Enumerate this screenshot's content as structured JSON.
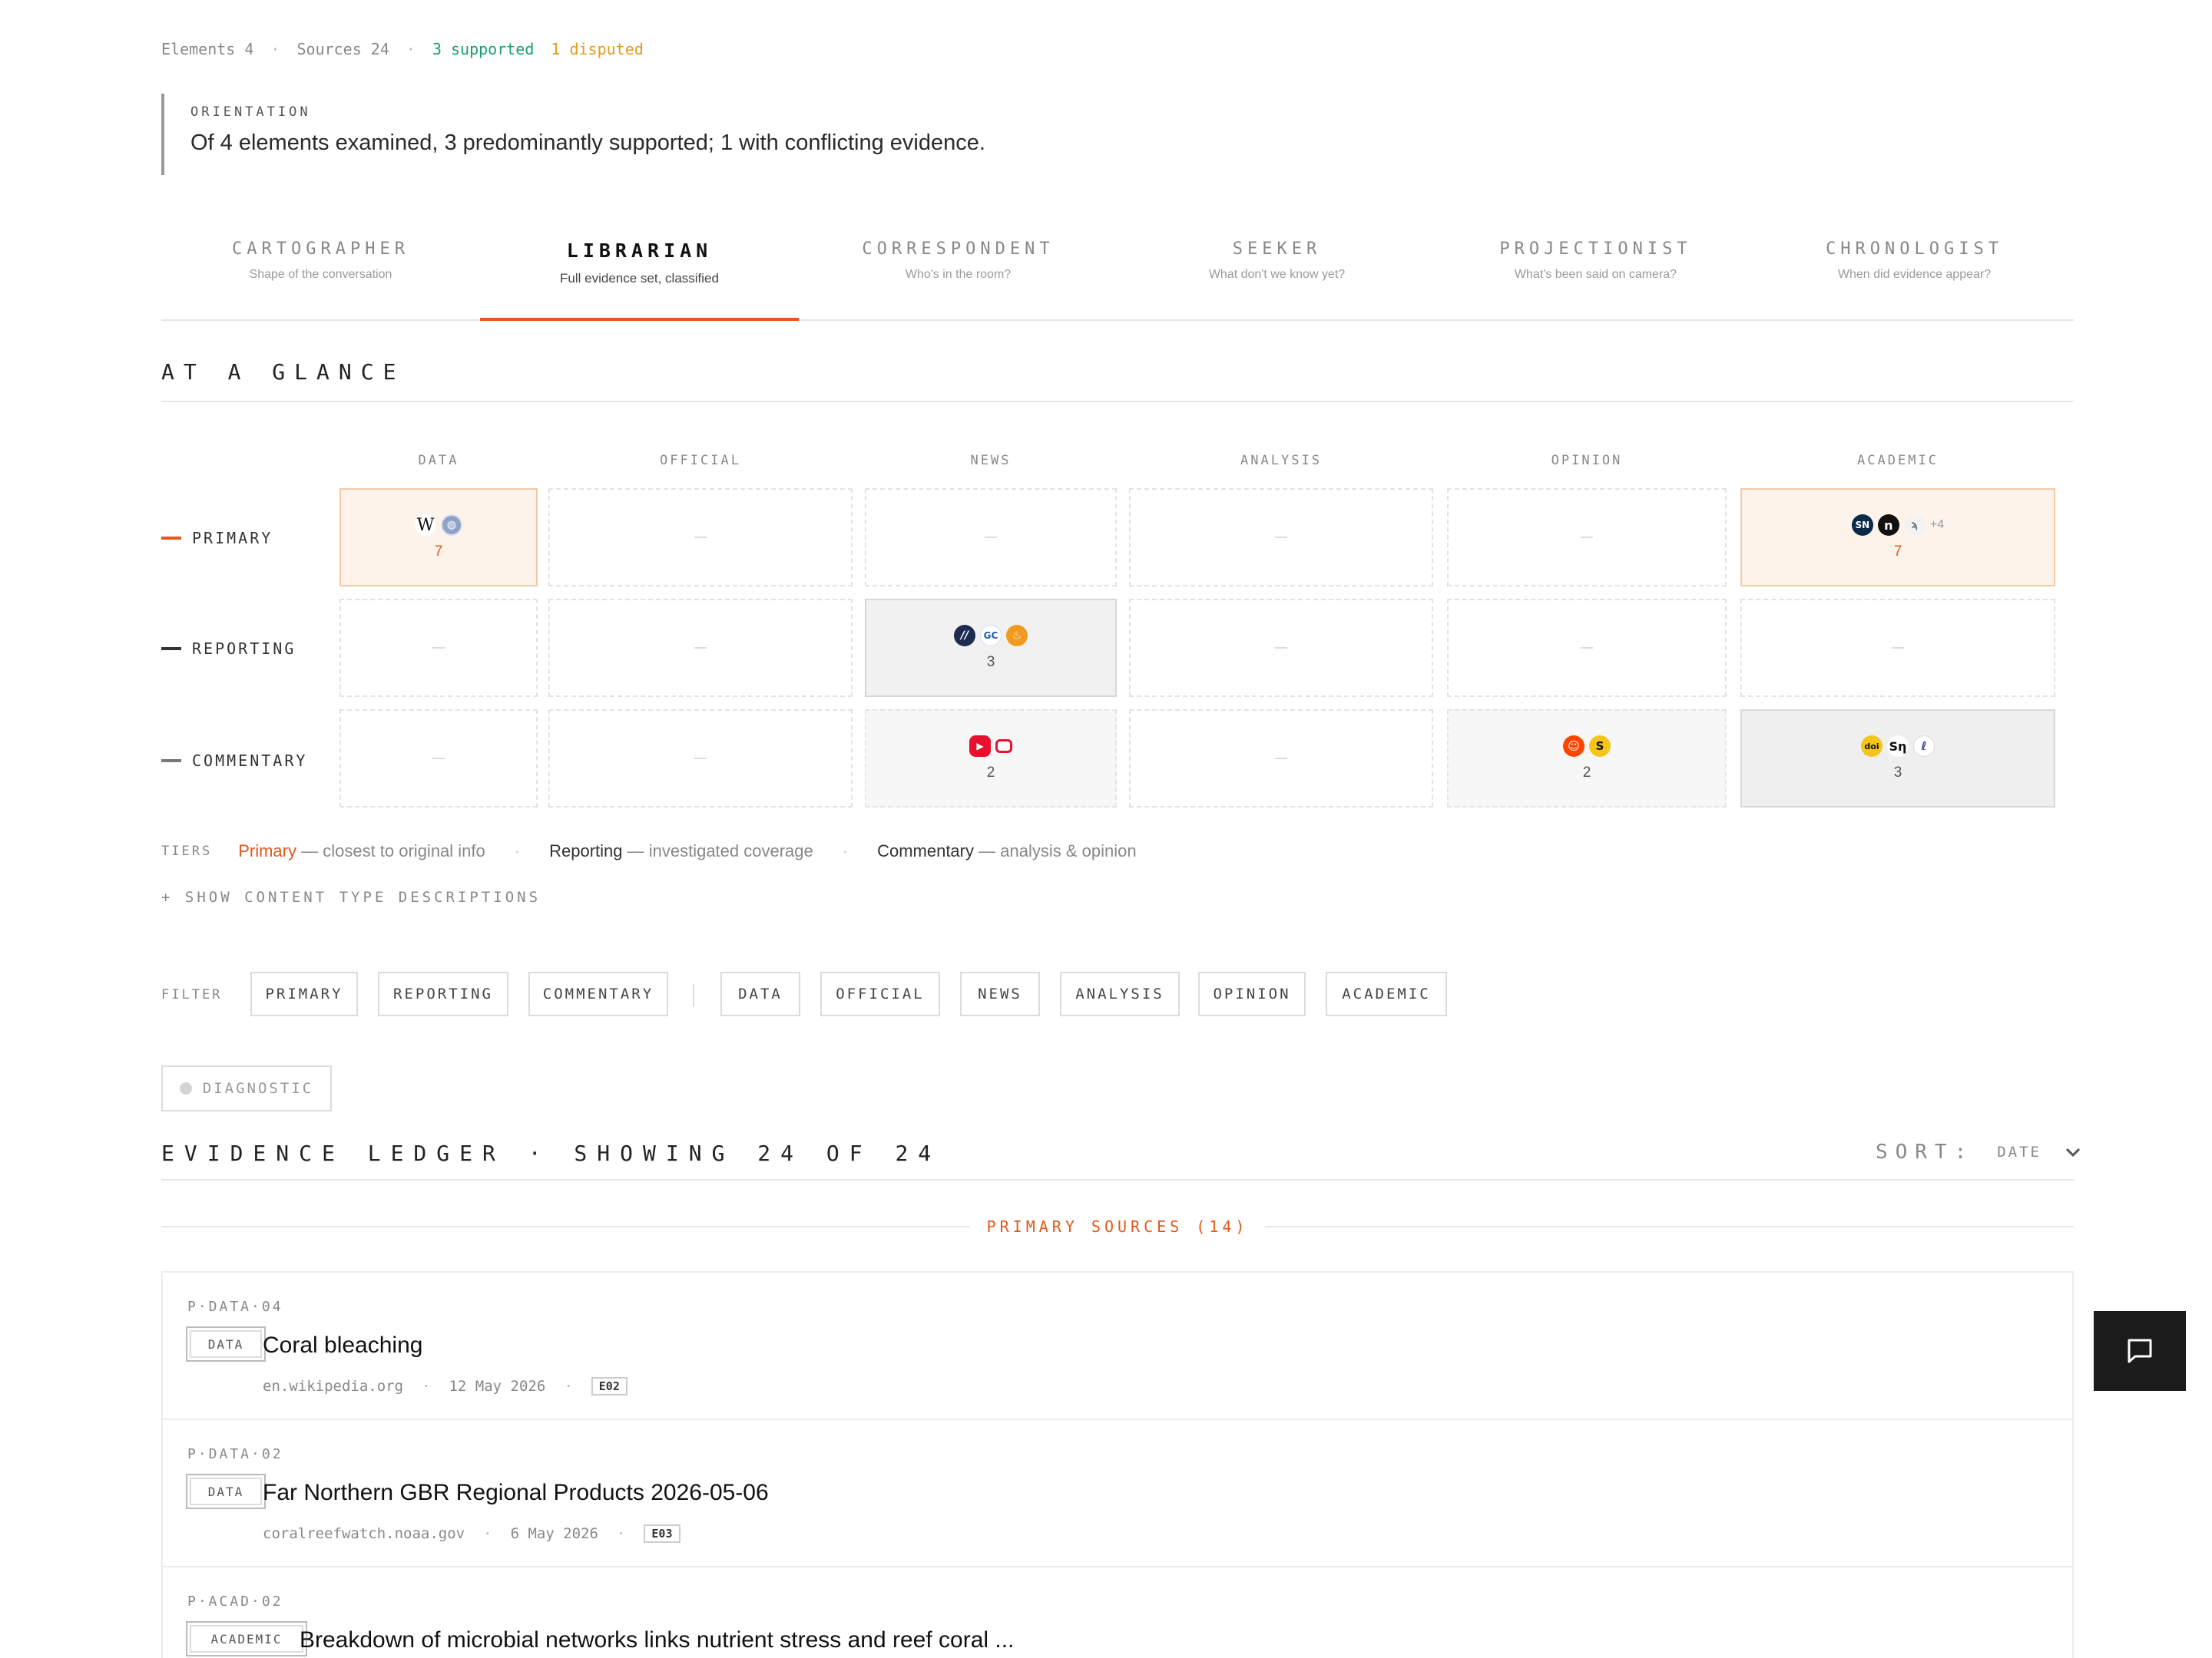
{
  "stats": {
    "elements": "Elements 4",
    "sources": "Sources 24",
    "supported": "3 supported",
    "disputed": "1 disputed"
  },
  "orientation": {
    "label": "ORIENTATION",
    "text": "Of 4 elements examined, 3 predominantly supported; 1 with conflicting evidence."
  },
  "tabs": [
    {
      "title": "CARTOGRAPHER",
      "subtitle": "Shape of the conversation"
    },
    {
      "title": "LIBRARIAN",
      "subtitle": "Full evidence set, classified",
      "active": true
    },
    {
      "title": "CORRESPONDENT",
      "subtitle": "Who's in the room?"
    },
    {
      "title": "SEEKER",
      "subtitle": "What don't we know yet?"
    },
    {
      "title": "PROJECTIONIST",
      "subtitle": "What's been said on camera?"
    },
    {
      "title": "CHRONOLOGIST",
      "subtitle": "When did evidence appear?"
    }
  ],
  "glance": {
    "title": "AT A GLANCE",
    "columns": [
      "DATA",
      "OFFICIAL",
      "NEWS",
      "ANALYSIS",
      "OPINION",
      "ACADEMIC"
    ],
    "rows": [
      "PRIMARY",
      "REPORTING",
      "COMMENTARY"
    ],
    "cells": {
      "primary_data": {
        "count": "7",
        "icons": [
          "wikipedia-icon",
          "globe-icon"
        ]
      },
      "primary_academic": {
        "count": "7",
        "icons": [
          "springer-nature-icon",
          "n-publisher-icon",
          "quill-icon"
        ],
        "more": "+4"
      },
      "reporting_news": {
        "count": "3",
        "icons": [
          "news-outlet-icon",
          "gc-outlet-icon",
          "flame-outlet-icon"
        ]
      },
      "commentary_news": {
        "count": "2",
        "icons": [
          "youtube-icon",
          "video-outlet-icon"
        ]
      },
      "commentary_opinion": {
        "count": "2",
        "icons": [
          "reddit-icon",
          "substack-icon"
        ]
      },
      "commentary_academic": {
        "count": "3",
        "icons": [
          "doi-icon",
          "sn-icon",
          "pen-icon"
        ]
      }
    }
  },
  "tiers": {
    "label": "TIERS",
    "primary": "Primary",
    "primary_desc": "— closest to original info",
    "reporting": "Reporting",
    "reporting_desc": "— investigated coverage",
    "commentary": "Commentary",
    "commentary_desc": "— analysis & opinion",
    "separator": "·"
  },
  "show_descriptions": "+ SHOW CONTENT TYPE DESCRIPTIONS",
  "filter": {
    "label": "FILTER",
    "tier_buttons": [
      "PRIMARY",
      "REPORTING",
      "COMMENTARY"
    ],
    "type_buttons": [
      "DATA",
      "OFFICIAL",
      "NEWS",
      "ANALYSIS",
      "OPINION",
      "ACADEMIC"
    ]
  },
  "diagnostic": "DIAGNOSTIC",
  "ledger": {
    "title": "EVIDENCE LEDGER · SHOWING 24 OF 24",
    "sort_label": "SORT:",
    "sort_value": "DATE",
    "group_title": "PRIMARY SOURCES (14)",
    "entries": [
      {
        "id": "P·DATA·04",
        "badge": "DATA",
        "title": "Coral bleaching",
        "domain": "en.wikipedia.org",
        "date": "12 May 2026",
        "element": "E02"
      },
      {
        "id": "P·DATA·02",
        "badge": "DATA",
        "title": "Far Northern GBR Regional Products 2026-05-06",
        "domain": "coralreefwatch.noaa.gov",
        "date": "6 May 2026",
        "element": "E03"
      },
      {
        "id": "P·ACAD·02",
        "badge": "ACADEMIC",
        "title": "Breakdown of microbial networks links nutrient stress and reef coral ..."
      }
    ]
  },
  "colors": {
    "accent": "#e2591a",
    "supported": "#1a9e6e",
    "disputed": "#e39a1c"
  }
}
